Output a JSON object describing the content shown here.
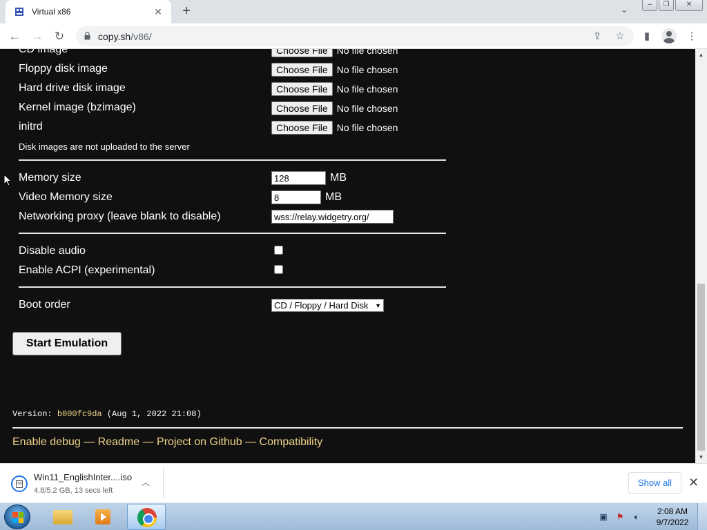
{
  "browser": {
    "tab_title": "Virtual x86",
    "new_tab": "+",
    "url_host": "copy.sh",
    "url_path": "/v86/"
  },
  "form": {
    "cd_label": "CD image",
    "floppy_label": "Floppy disk image",
    "hdd_label": "Hard drive disk image",
    "kernel_label": "Kernel image (bzimage)",
    "initrd_label": "initrd",
    "choose_file": "Choose File",
    "no_file": "No file chosen",
    "disk_note": "Disk images are not uploaded to the server",
    "memory_label": "Memory size",
    "memory_value": "128",
    "video_memory_label": "Video Memory size",
    "video_memory_value": "8",
    "unit_mb": "MB",
    "proxy_label": "Networking proxy (leave blank to disable)",
    "proxy_value": "wss://relay.widgetry.org/",
    "disable_audio_label": "Disable audio",
    "disable_audio_checked": false,
    "acpi_label": "Enable ACPI (experimental)",
    "acpi_checked": false,
    "boot_order_label": "Boot order",
    "boot_order_value": "CD / Floppy / Hard Disk",
    "start_button": "Start Emulation"
  },
  "footer": {
    "version_prefix": "Version: ",
    "version_hash": "b000fc9da",
    "version_date": " (Aug 1, 2022 21:08)",
    "link_debug": "Enable debug",
    "link_readme": "Readme",
    "link_github": "Project on Github",
    "link_compat": "Compatibility",
    "separator": " — "
  },
  "download": {
    "file_name": "Win11_EnglishInter....iso",
    "status": "4.8/5.2 GB, 13 secs left",
    "icon_text": "ISO",
    "show_all": "Show all"
  },
  "taskbar": {
    "time": "2:08 AM",
    "date": "9/7/2022"
  },
  "colors": {
    "page_bg": "#101010",
    "link_color": "#f0d58a",
    "accent_blue": "#1a73e8"
  }
}
